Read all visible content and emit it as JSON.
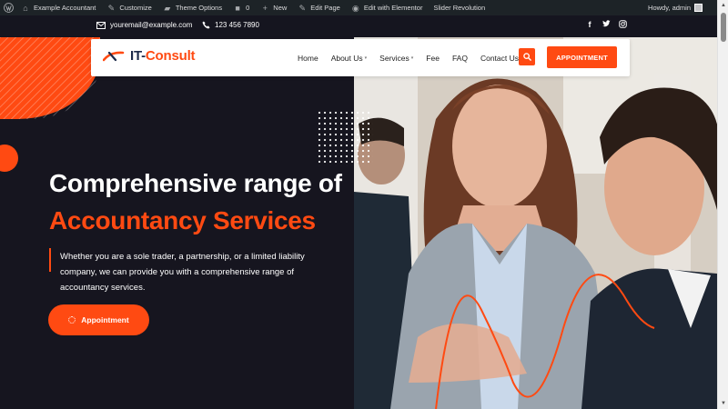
{
  "admin_bar": {
    "items": [
      {
        "icon": "wordpress-icon",
        "label": ""
      },
      {
        "icon": "home-icon",
        "label": "Example Accountant"
      },
      {
        "icon": "brush-icon",
        "label": "Customize"
      },
      {
        "icon": "theme-options-icon",
        "label": "Theme Options"
      },
      {
        "icon": "comment-icon",
        "label": "0"
      },
      {
        "icon": "plus-icon",
        "label": "New"
      },
      {
        "icon": "pencil-icon",
        "label": "Edit Page"
      },
      {
        "icon": "elementor-icon",
        "label": "Edit with Elementor"
      },
      {
        "icon": "",
        "label": "Slider Revolution"
      }
    ],
    "greeting": "Howdy, admin"
  },
  "topbar": {
    "email": "youremail@example.com",
    "phone": "123 456 7890",
    "social": [
      "facebook-icon",
      "twitter-icon",
      "instagram-icon"
    ]
  },
  "header": {
    "logo_main": "IT-",
    "logo_accent": "Consult",
    "nav": [
      {
        "label": "Home",
        "dropdown": false
      },
      {
        "label": "About Us",
        "dropdown": true
      },
      {
        "label": "Services",
        "dropdown": true
      },
      {
        "label": "Fee",
        "dropdown": false
      },
      {
        "label": "FAQ",
        "dropdown": false
      },
      {
        "label": "Contact Us",
        "dropdown": false
      }
    ],
    "cta": "APPOINTMENT"
  },
  "hero": {
    "title_line1": "Comprehensive range of",
    "title_line2": "Accountancy Services",
    "description": "Whether you are a sole trader, a partnership, or a limited liability company, we can provide you with a comprehensive range of accountancy services.",
    "button": "Appointment"
  },
  "colors": {
    "accent": "#ff4a12",
    "dark": "#16151f",
    "admin_bar": "#1d2327"
  }
}
